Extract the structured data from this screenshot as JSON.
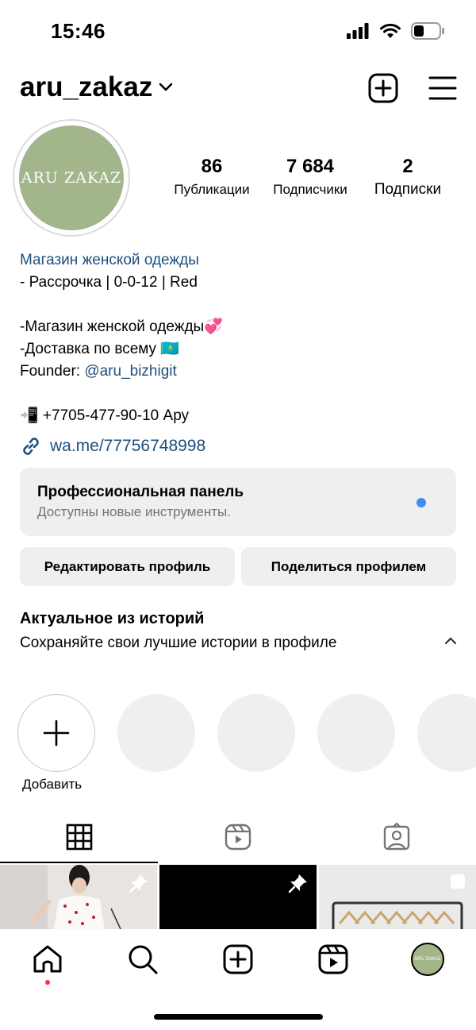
{
  "status": {
    "time": "15:46"
  },
  "header": {
    "username": "aru_zakaz"
  },
  "profile": {
    "avatar_text": "ARU ZAKAZ",
    "stats": [
      {
        "value": "86",
        "label": "Публикации"
      },
      {
        "value": "7 684",
        "label": "Подписчики"
      },
      {
        "value": "2",
        "label": "Подписки"
      }
    ]
  },
  "bio": {
    "category": "Магазин женской одежды",
    "lines": [
      "- Рассрочка | 0-0-12 | Red",
      "",
      "-Магазин женской одежды💞",
      "-Доставка по всему 🇰🇿"
    ],
    "founder_prefix": "Founder: ",
    "founder_handle": "@aru_bizhigit",
    "phone": "📲 +7705-477-90-10 Ару",
    "link": "wa.me/77756748998"
  },
  "pro_panel": {
    "title": "Профессиональная панель",
    "subtitle": "Доступны новые инструменты."
  },
  "buttons": {
    "edit": "Редактировать профиль",
    "share": "Поделиться профилем"
  },
  "highlights": {
    "title": "Актуальное из историй",
    "subtitle": "Сохраняйте свои лучшие истории в профиле",
    "add_label": "Добавить"
  },
  "colors": {
    "accent_link": "#1d4f7e",
    "notify_dot": "#3f8cf4",
    "avatar_bg": "#a3b58a"
  }
}
